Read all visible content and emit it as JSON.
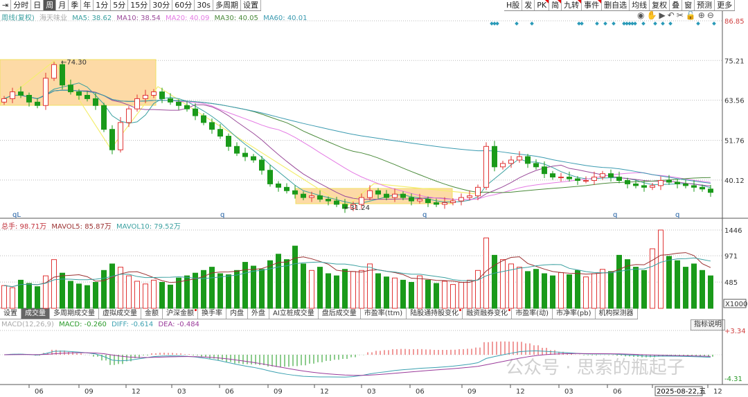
{
  "toolbar_left": [
    "分时",
    "日",
    "周",
    "月",
    "季",
    "年",
    "1分",
    "5分",
    "15分",
    "30分",
    "60分",
    "30s",
    "多周期",
    "设置"
  ],
  "toolbar_left_active": "周",
  "toolbar_right": [
    "H股",
    "发",
    "PK",
    "简",
    "九转",
    "事件",
    "删自选",
    "均线",
    "复权",
    "叠",
    "窗",
    "预测",
    "更多"
  ],
  "toolbar_right_red": [
    "PK",
    "简",
    "九转",
    "事件"
  ],
  "chart_icons": [
    "eye-icon",
    "hand-icon",
    "play-icon",
    "undo-icon",
    "scissors-icon",
    "lock-icon",
    "zoom-in-icon",
    "zoom-out-icon"
  ],
  "price_info": {
    "period": "周线(复权)",
    "name": "海天味业",
    "ma5": "MA5: 38.62",
    "ma10": "MA10: 38.54",
    "ma20": "MA20: 40.09",
    "ma30": "MA30: 40.05",
    "ma60": "MA60: 40.01"
  },
  "volume_info": {
    "total": "总手: 98.71万",
    "mavol5": "MAVOL5: 85.87万",
    "mavol10": "MAVOL10: 79.52万"
  },
  "macd_info": {
    "label": "MACD(12,26,9)",
    "macd": "MACD: -0.260",
    "diff": "DIFF: -0.614",
    "dea": "DEA: -0.484"
  },
  "indicator_tabs": [
    "设置",
    "成交量",
    "多周期成交量",
    "虚拟成交量",
    "金额",
    "沪深金额",
    "换手率",
    "内盘",
    "外盘",
    "AI立桩成交量",
    "盘后成交量",
    "市盈率(ttm)",
    "陆股通持股变化",
    "融资融券变化",
    "市盈率(动)",
    "市净率(pb)",
    "机构探测器"
  ],
  "indicator_tabs_active": "成交量",
  "indicator_tabs_red": [
    "沪深金额",
    "陆股通持股变化",
    "融资融券变化"
  ],
  "indicator_help": "指标说明",
  "watermark": "公众号 · 思索的瓶起子",
  "colors": {
    "up": "#e03434",
    "down": "#1a9a1a",
    "ma5": "#3aa0a0",
    "ma10": "#9a4a9a",
    "ma20": "#e47ae4",
    "ma30": "#4a8a3a",
    "ma60": "#3a9ab0",
    "highlight": "#fddaa6"
  },
  "chart_data": {
    "type": "candlestick",
    "price_axis": {
      "ticks": [
        "86.85",
        "75.21",
        "63.56",
        "51.76",
        "40.12"
      ],
      "range": [
        31.24,
        86.85
      ]
    },
    "annotations": {
      "high": "74.30",
      "low": "31.24"
    },
    "markers": [
      "qL",
      "q",
      "q",
      "q",
      "q"
    ],
    "close": [
      64,
      66,
      65,
      63,
      62,
      70,
      74,
      68,
      66,
      65,
      64,
      62,
      55,
      49,
      57,
      61,
      64,
      65,
      66,
      64,
      63,
      62,
      61,
      59,
      57,
      55,
      53,
      50,
      48,
      47,
      46,
      43,
      39,
      38,
      37,
      36,
      35,
      35.5,
      34.5,
      34,
      33,
      31.8,
      33,
      35,
      37,
      36,
      35,
      36,
      35,
      34,
      34.5,
      33.5,
      33,
      33.5,
      34,
      35,
      35.5,
      38,
      50,
      44,
      45,
      46,
      47,
      45,
      44,
      42,
      41,
      41,
      40.5,
      40,
      40,
      41,
      42,
      41,
      40,
      39,
      38.5,
      38,
      38.5,
      40,
      39.5,
      39,
      38.5,
      38,
      37.5,
      36.5
    ],
    "volume": [
      420,
      380,
      520,
      460,
      400,
      600,
      900,
      650,
      500,
      450,
      420,
      480,
      700,
      820,
      760,
      600,
      500,
      450,
      520,
      480,
      430,
      560,
      600,
      650,
      700,
      760,
      640,
      620,
      700,
      850,
      780,
      720,
      880,
      1000,
      900,
      1150,
      820,
      700,
      760,
      640,
      600,
      720,
      680,
      700,
      820,
      640,
      580,
      560,
      520,
      480,
      600,
      520,
      460,
      500,
      440,
      480,
      520,
      700,
      1300,
      980,
      900,
      820,
      760,
      680,
      720,
      640,
      600,
      660,
      620,
      700,
      580,
      640,
      720,
      680,
      980,
      900,
      760,
      700,
      1100,
      1446,
      960,
      880,
      760,
      820,
      700,
      600
    ],
    "volume_axis": {
      "ticks": [
        "1446",
        "971",
        "485"
      ],
      "unit": "X1000"
    },
    "macd_axis": {
      "ticks": [
        "+3.34",
        "-4.31"
      ]
    },
    "x_ticks": [
      "06",
      "09",
      "12",
      "03",
      "06",
      "09",
      "12",
      "03",
      "06",
      "09",
      "12",
      "03",
      "06",
      "2025-08-22,五",
      "12"
    ]
  }
}
